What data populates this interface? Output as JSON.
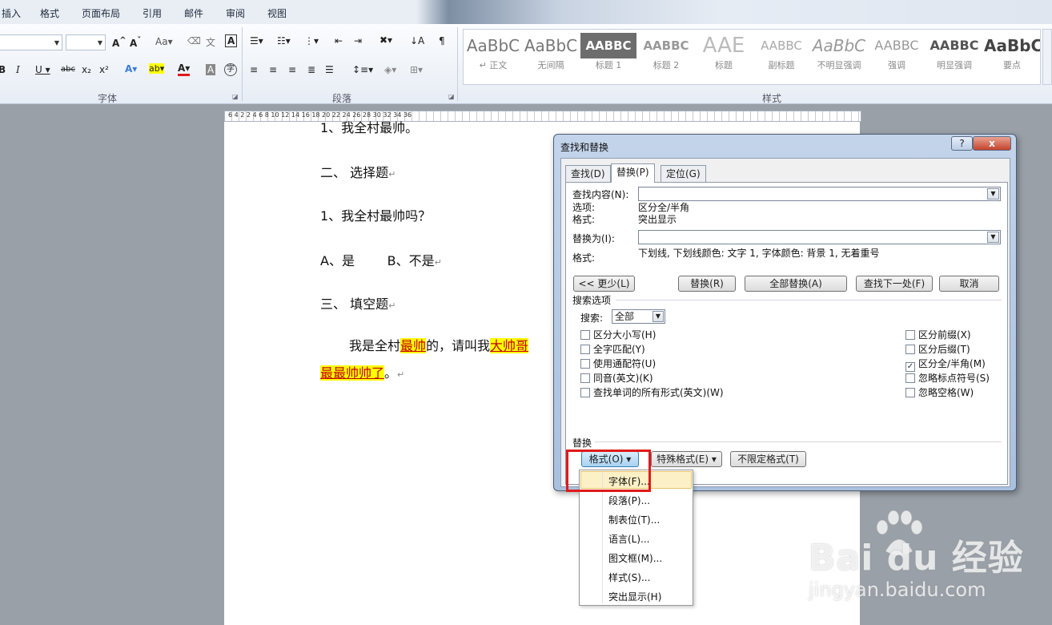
{
  "ribbon": {
    "tabs": [
      "插入",
      "格式",
      "页面布局",
      "引用",
      "邮件",
      "审阅",
      "视图"
    ],
    "groups": {
      "font": "字体",
      "paragraph": "段落",
      "styles": "样式"
    },
    "styles": [
      {
        "preview": "AaBbC",
        "name": "↵ 正文",
        "dark": false
      },
      {
        "preview": "AaBbC",
        "name": "无间隔",
        "dark": false
      },
      {
        "preview": "AABBC",
        "name": "标题 1",
        "dark": true
      },
      {
        "preview": "AABBC",
        "name": "标题 2",
        "dark": false
      },
      {
        "preview": "AAE",
        "name": "标题",
        "dark": false
      },
      {
        "preview": "AABBC",
        "name": "副标题",
        "dark": false
      },
      {
        "preview": "AaBbC",
        "name": "不明显强调",
        "dark": false
      },
      {
        "preview": "AABBC",
        "name": "强调",
        "dark": false
      },
      {
        "preview": "AABBC",
        "name": "明显强调",
        "dark": false
      },
      {
        "preview": "AaBbC",
        "name": "要点",
        "dark": false
      }
    ]
  },
  "ruler": {
    "numbers": "6  4  2     2  4  6  8  10  12  14  16  18  20  22  24  26  28  30  32  34  36"
  },
  "document": {
    "line0": "1、我全村最帅。",
    "heading2": "二、  选择题",
    "q1": "1、我全村最帅吗？",
    "options": "A、是        B、不是",
    "heading3": "三、  填空题",
    "para_a": "我是全村",
    "para_hl1": "最帅",
    "para_b": "的，请叫我",
    "para_hl2": "大帅哥",
    "para2_hl": "最最帅帅了",
    "para2_end": "。",
    "mark": "↵"
  },
  "dialog": {
    "title": "查找和替换",
    "help": "?",
    "close": "x",
    "tabs": [
      "查找(D)",
      "替换(P)",
      "定位(G)"
    ],
    "find_label": "查找内容(N):",
    "find_value": "",
    "options_label": "选项:",
    "options_value": "区分全/半角",
    "format_label": "格式:",
    "format_value": "突出显示",
    "replace_label": "替换为(I):",
    "replace_value": "",
    "replace_format_label": "格式:",
    "replace_format_value": "下划线, 下划线颜色: 文字 1, 字体颜色: 背景 1, 无着重号",
    "buttons": {
      "less": "<< 更少(L)",
      "replace": "替换(R)",
      "replace_all": "全部替换(A)",
      "find_next": "查找下一处(F)",
      "cancel": "取消"
    },
    "search_options_title": "搜索选项",
    "search_label": "搜索:",
    "search_value": "全部",
    "left_options": [
      {
        "label": "区分大小写(H)",
        "checked": false
      },
      {
        "label": "全字匹配(Y)",
        "checked": false
      },
      {
        "label": "使用通配符(U)",
        "checked": false
      },
      {
        "label": "同音(英文)(K)",
        "checked": false
      },
      {
        "label": "查找单词的所有形式(英文)(W)",
        "checked": false
      }
    ],
    "right_options": [
      {
        "label": "区分前缀(X)",
        "checked": false
      },
      {
        "label": "区分后缀(T)",
        "checked": false
      },
      {
        "label": "区分全/半角(M)",
        "checked": true
      },
      {
        "label": "忽略标点符号(S)",
        "checked": false
      },
      {
        "label": "忽略空格(W)",
        "checked": false
      }
    ],
    "replace_section": "替换",
    "format_btn": "格式(O) ▾",
    "special_btn": "特殊格式(E) ▾",
    "no_format_btn": "不限定格式(T)"
  },
  "menu": {
    "items": [
      "字体(F)...",
      "段落(P)...",
      "制表位(T)...",
      "语言(L)...",
      "图文框(M)...",
      "样式(S)...",
      "突出显示(H)"
    ]
  },
  "watermark": {
    "brand": "Bai  du 经验",
    "url": "jingyan.baidu.com"
  },
  "colors": {
    "highlight": "#ffff00",
    "annotation": "#e01a1a",
    "dialog_frame": "#a9c0de"
  }
}
